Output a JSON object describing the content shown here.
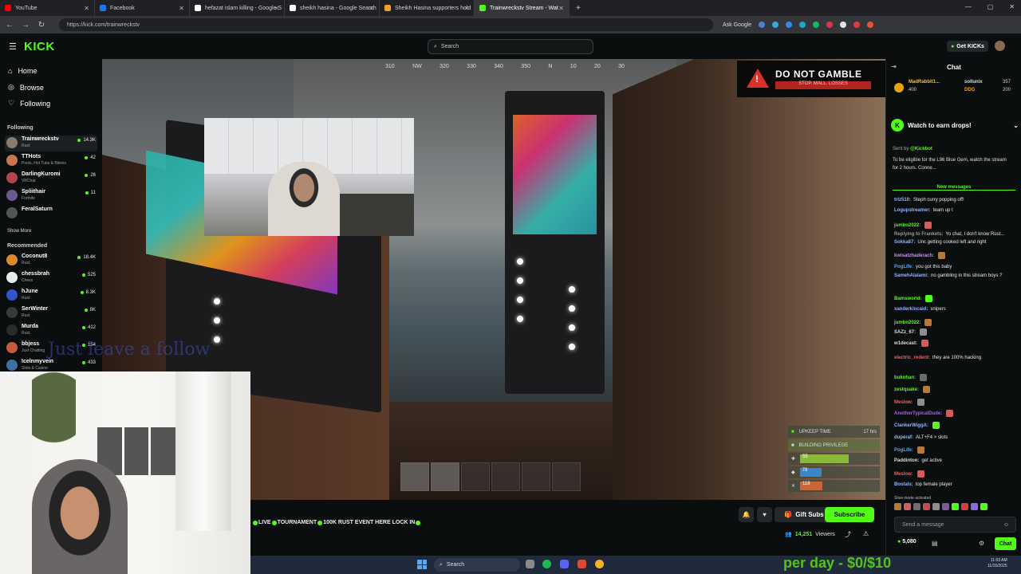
{
  "browser": {
    "tabs": [
      {
        "title": "YouTube",
        "color": "#ff0000",
        "active": false
      },
      {
        "title": "Facebook",
        "color": "#1877f2",
        "active": false
      },
      {
        "title": "hefazat islam killing - Google S",
        "color": "#ffffff",
        "active": false
      },
      {
        "title": "sheikh hasina - Google Search",
        "color": "#ffffff",
        "active": false
      },
      {
        "title": "Sheikh Hasina supporters hold",
        "color": "#f0a020",
        "active": false
      },
      {
        "title": "Trainwreckstv Stream - Wat",
        "color": "#53fc18",
        "active": true
      }
    ],
    "url": "https://kick.com/trainwreckstv",
    "ask_google": "Ask Google"
  },
  "kick": {
    "logo": "KICK",
    "search_placeholder": "Search",
    "get_kicks": "Get KICKs"
  },
  "sidebar": {
    "nav": [
      {
        "label": "Home",
        "icon": "home-icon"
      },
      {
        "label": "Browse",
        "icon": "browse-icon"
      },
      {
        "label": "Following",
        "icon": "heart-icon"
      }
    ],
    "following_title": "Following",
    "following": [
      {
        "name": "Trainwreckstv",
        "game": "Rust",
        "viewers": "14.3K",
        "color": "#8a7a6a"
      },
      {
        "name": "TTHots",
        "game": "Pools, Hot Tubs & Bikinis",
        "viewers": "42",
        "color": "#c9754e"
      },
      {
        "name": "DarlingKuromi",
        "game": "VRChat",
        "viewers": "26",
        "color": "#b0454a"
      },
      {
        "name": "Spliithair",
        "game": "Fortnite",
        "viewers": "11",
        "color": "#6a5b8c"
      },
      {
        "name": "FeralSaturn",
        "game": "",
        "viewers": "",
        "color": "#555555"
      }
    ],
    "show_more": "Show More",
    "recommended_title": "Recommended",
    "recommended": [
      {
        "name": "Coconut8",
        "game": "Rust",
        "viewers": "18.4K",
        "color": "#d98a2b"
      },
      {
        "name": "chessbrah",
        "game": "Chess",
        "viewers": "525",
        "color": "#eaeaea"
      },
      {
        "name": "hJune",
        "game": "Rust",
        "viewers": "8.3K",
        "color": "#3253c9"
      },
      {
        "name": "SerWinter",
        "game": "Rust",
        "viewers": "8K",
        "color": "#3a3a3a"
      },
      {
        "name": "Murda",
        "game": "Rust",
        "viewers": "412",
        "color": "#2b2b2b"
      },
      {
        "name": "bbjess",
        "game": "Just Chatting",
        "viewers": "154",
        "color": "#c55b3b"
      },
      {
        "name": "Icelnmyvein",
        "game": "Slots & Casino",
        "viewers": "433",
        "color": "#3d6fa0"
      }
    ]
  },
  "video": {
    "compass": [
      "310",
      "NW",
      "320",
      "330",
      "340",
      "350",
      "N",
      "10",
      "20",
      "30"
    ],
    "banner_title": "DO NOT GAMBLE",
    "banner_sub": "STOP. MALL. LOSSES",
    "overlay_text": "Just leave a follow",
    "hud": {
      "upkeep": "UPKEEP TIME",
      "upkeep_val": "17 hrs",
      "privilege": "BUILDING PRIVILEGE",
      "health": "55",
      "water": "78",
      "food": "118"
    }
  },
  "stream": {
    "ticker": [
      "LIVE",
      "TOURNAMENT",
      "100K RUST EVENT HERE LOCK IN",
      ""
    ],
    "gift_subs": "Gift Subs",
    "subscribe": "Subscribe",
    "viewer_count": "14,251",
    "viewers_label": "Viewers"
  },
  "chat": {
    "title": "Chat",
    "pinned": [
      {
        "user": "MadRabbit1...",
        "amount": "400"
      },
      {
        "user": "sollunix",
        "amount": "357"
      },
      {
        "user": "DDG",
        "amount": "200"
      }
    ],
    "drops_title": "Watch to earn drops!",
    "drop_sender": "Sent by",
    "drop_sender_name": "@Kickbot",
    "drop_text": "To be eligible for the L96 Blue Gem, watch the stream for 2 hours. Conne...",
    "new_messages": "New messages",
    "messages": [
      {
        "user": "trlz510:",
        "color": "#8fb4ff",
        "text": "Steph curry popping off!"
      },
      {
        "user": "Logupstreamer:",
        "color": "#8fb4ff",
        "text": "team up t"
      },
      {
        "user": "jumbo2022:",
        "color": "#53fc18",
        "text": ""
      },
      {
        "user": "Replying to Frankets:",
        "color": "#9a9a9a",
        "text": "Yo chat, I don't know Rust..."
      },
      {
        "user": "Sokka87:",
        "color": "#8fb4ff",
        "text": "Unc getting cooked left and right"
      },
      {
        "user": "kwisatzhaderach:",
        "color": "#d28cff",
        "text": ""
      },
      {
        "user": "PogLife:",
        "color": "#4fa8ff",
        "text": "you got this baby"
      },
      {
        "user": "SamehAlalami:",
        "color": "#8fb4ff",
        "text": "no gambling in this stream boys ?"
      },
      {
        "user": "Bamsworld:",
        "color": "#53fc18",
        "text": ""
      },
      {
        "user": "xanderkincaid:",
        "color": "#8fb4ff",
        "text": "snipers"
      },
      {
        "user": "jumbo2022:",
        "color": "#53fc18",
        "text": ""
      },
      {
        "user": "SAZz_67:",
        "color": "#dddddd",
        "text": ""
      },
      {
        "user": "w1decast:",
        "color": "#dddddd",
        "text": ""
      },
      {
        "user": "electric_rodent:",
        "color": "#ff5a5a",
        "text": "they are 100% hacking"
      },
      {
        "user": "bukohan:",
        "color": "#53fc18",
        "text": ""
      },
      {
        "user": "zestquake:",
        "color": "#53fc18",
        "text": ""
      },
      {
        "user": "Meslow:",
        "color": "#ff5a5a",
        "text": ""
      },
      {
        "user": "AnotherTypicalDude:",
        "color": "#b455ff",
        "text": ""
      },
      {
        "user": "ClankerWiggA:",
        "color": "#8fb4ff",
        "text": ""
      },
      {
        "user": "duperaf:",
        "color": "#8fb4ff",
        "text": "ALT+F4 > slots"
      },
      {
        "user": "PogLife:",
        "color": "#4fa8ff",
        "text": ""
      },
      {
        "user": "Paddinton:",
        "color": "#dddddd",
        "text": "get active"
      },
      {
        "user": "Meslow:",
        "color": "#ff5a5a",
        "text": ""
      },
      {
        "user": "Bostals:",
        "color": "#8fb4ff",
        "text": "top female player"
      }
    ],
    "slow_mode": "Slow mode activated",
    "input_placeholder": "Send a message",
    "kicks": "5,080",
    "chat_button": "Chat"
  },
  "taskbar": {
    "search": "Search",
    "overlay_price": "per day - $0/$10",
    "time": "11:03 AM",
    "date": "11/15/2025"
  }
}
